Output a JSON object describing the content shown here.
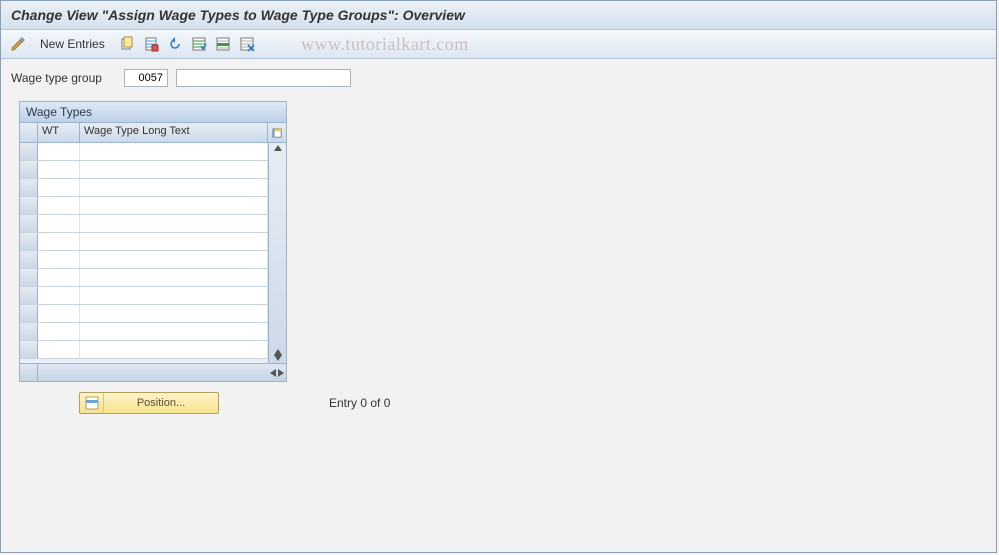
{
  "title": "Change View \"Assign Wage Types to Wage Type Groups\": Overview",
  "watermark": "www.tutorialkart.com",
  "toolbar": {
    "new_entries_label": "New Entries"
  },
  "field": {
    "label": "Wage type group",
    "code": "0057",
    "description": ""
  },
  "panel": {
    "title": "Wage Types",
    "columns": {
      "wt": "WT",
      "text": "Wage Type Long Text"
    },
    "rows": [
      {
        "wt": "",
        "text": ""
      },
      {
        "wt": "",
        "text": ""
      },
      {
        "wt": "",
        "text": ""
      },
      {
        "wt": "",
        "text": ""
      },
      {
        "wt": "",
        "text": ""
      },
      {
        "wt": "",
        "text": ""
      },
      {
        "wt": "",
        "text": ""
      },
      {
        "wt": "",
        "text": ""
      },
      {
        "wt": "",
        "text": ""
      },
      {
        "wt": "",
        "text": ""
      },
      {
        "wt": "",
        "text": ""
      },
      {
        "wt": "",
        "text": ""
      }
    ]
  },
  "footer": {
    "position_label": "Position...",
    "entry_count": "Entry 0 of 0"
  }
}
